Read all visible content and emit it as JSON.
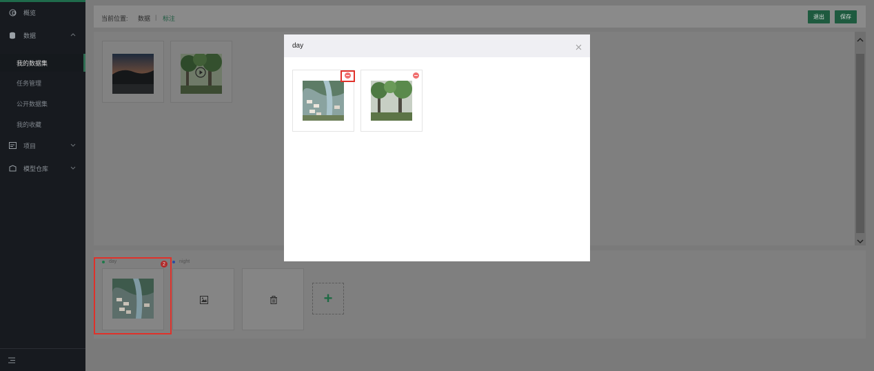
{
  "sidebar": {
    "items": [
      {
        "label": "概览",
        "icon": "overview-icon"
      },
      {
        "label": "数据",
        "icon": "database-icon"
      },
      {
        "label": "项目",
        "icon": "project-icon"
      },
      {
        "label": "模型仓库",
        "icon": "model-repo-icon"
      }
    ],
    "sub_items": [
      "我的数据集",
      "任务管理",
      "公开数据集",
      "我的收藏"
    ],
    "active_sub": "我的数据集"
  },
  "header": {
    "location_label": "当前位置:",
    "crumb_data": "数据",
    "crumb_sep": "|",
    "crumb_current": "标注",
    "exit_label": "退出",
    "save_label": "保存"
  },
  "bottom": {
    "labels": [
      {
        "name": "day",
        "count": "2",
        "color": "#1e7a4a"
      },
      {
        "name": "night",
        "color": "#2a4aa0"
      }
    ],
    "add_label": "+"
  },
  "modal": {
    "title": "day",
    "close_label": "×"
  },
  "colors": {
    "accent": "#1f6b4b",
    "highlight": "#e0312a",
    "delete": "#f07070"
  }
}
